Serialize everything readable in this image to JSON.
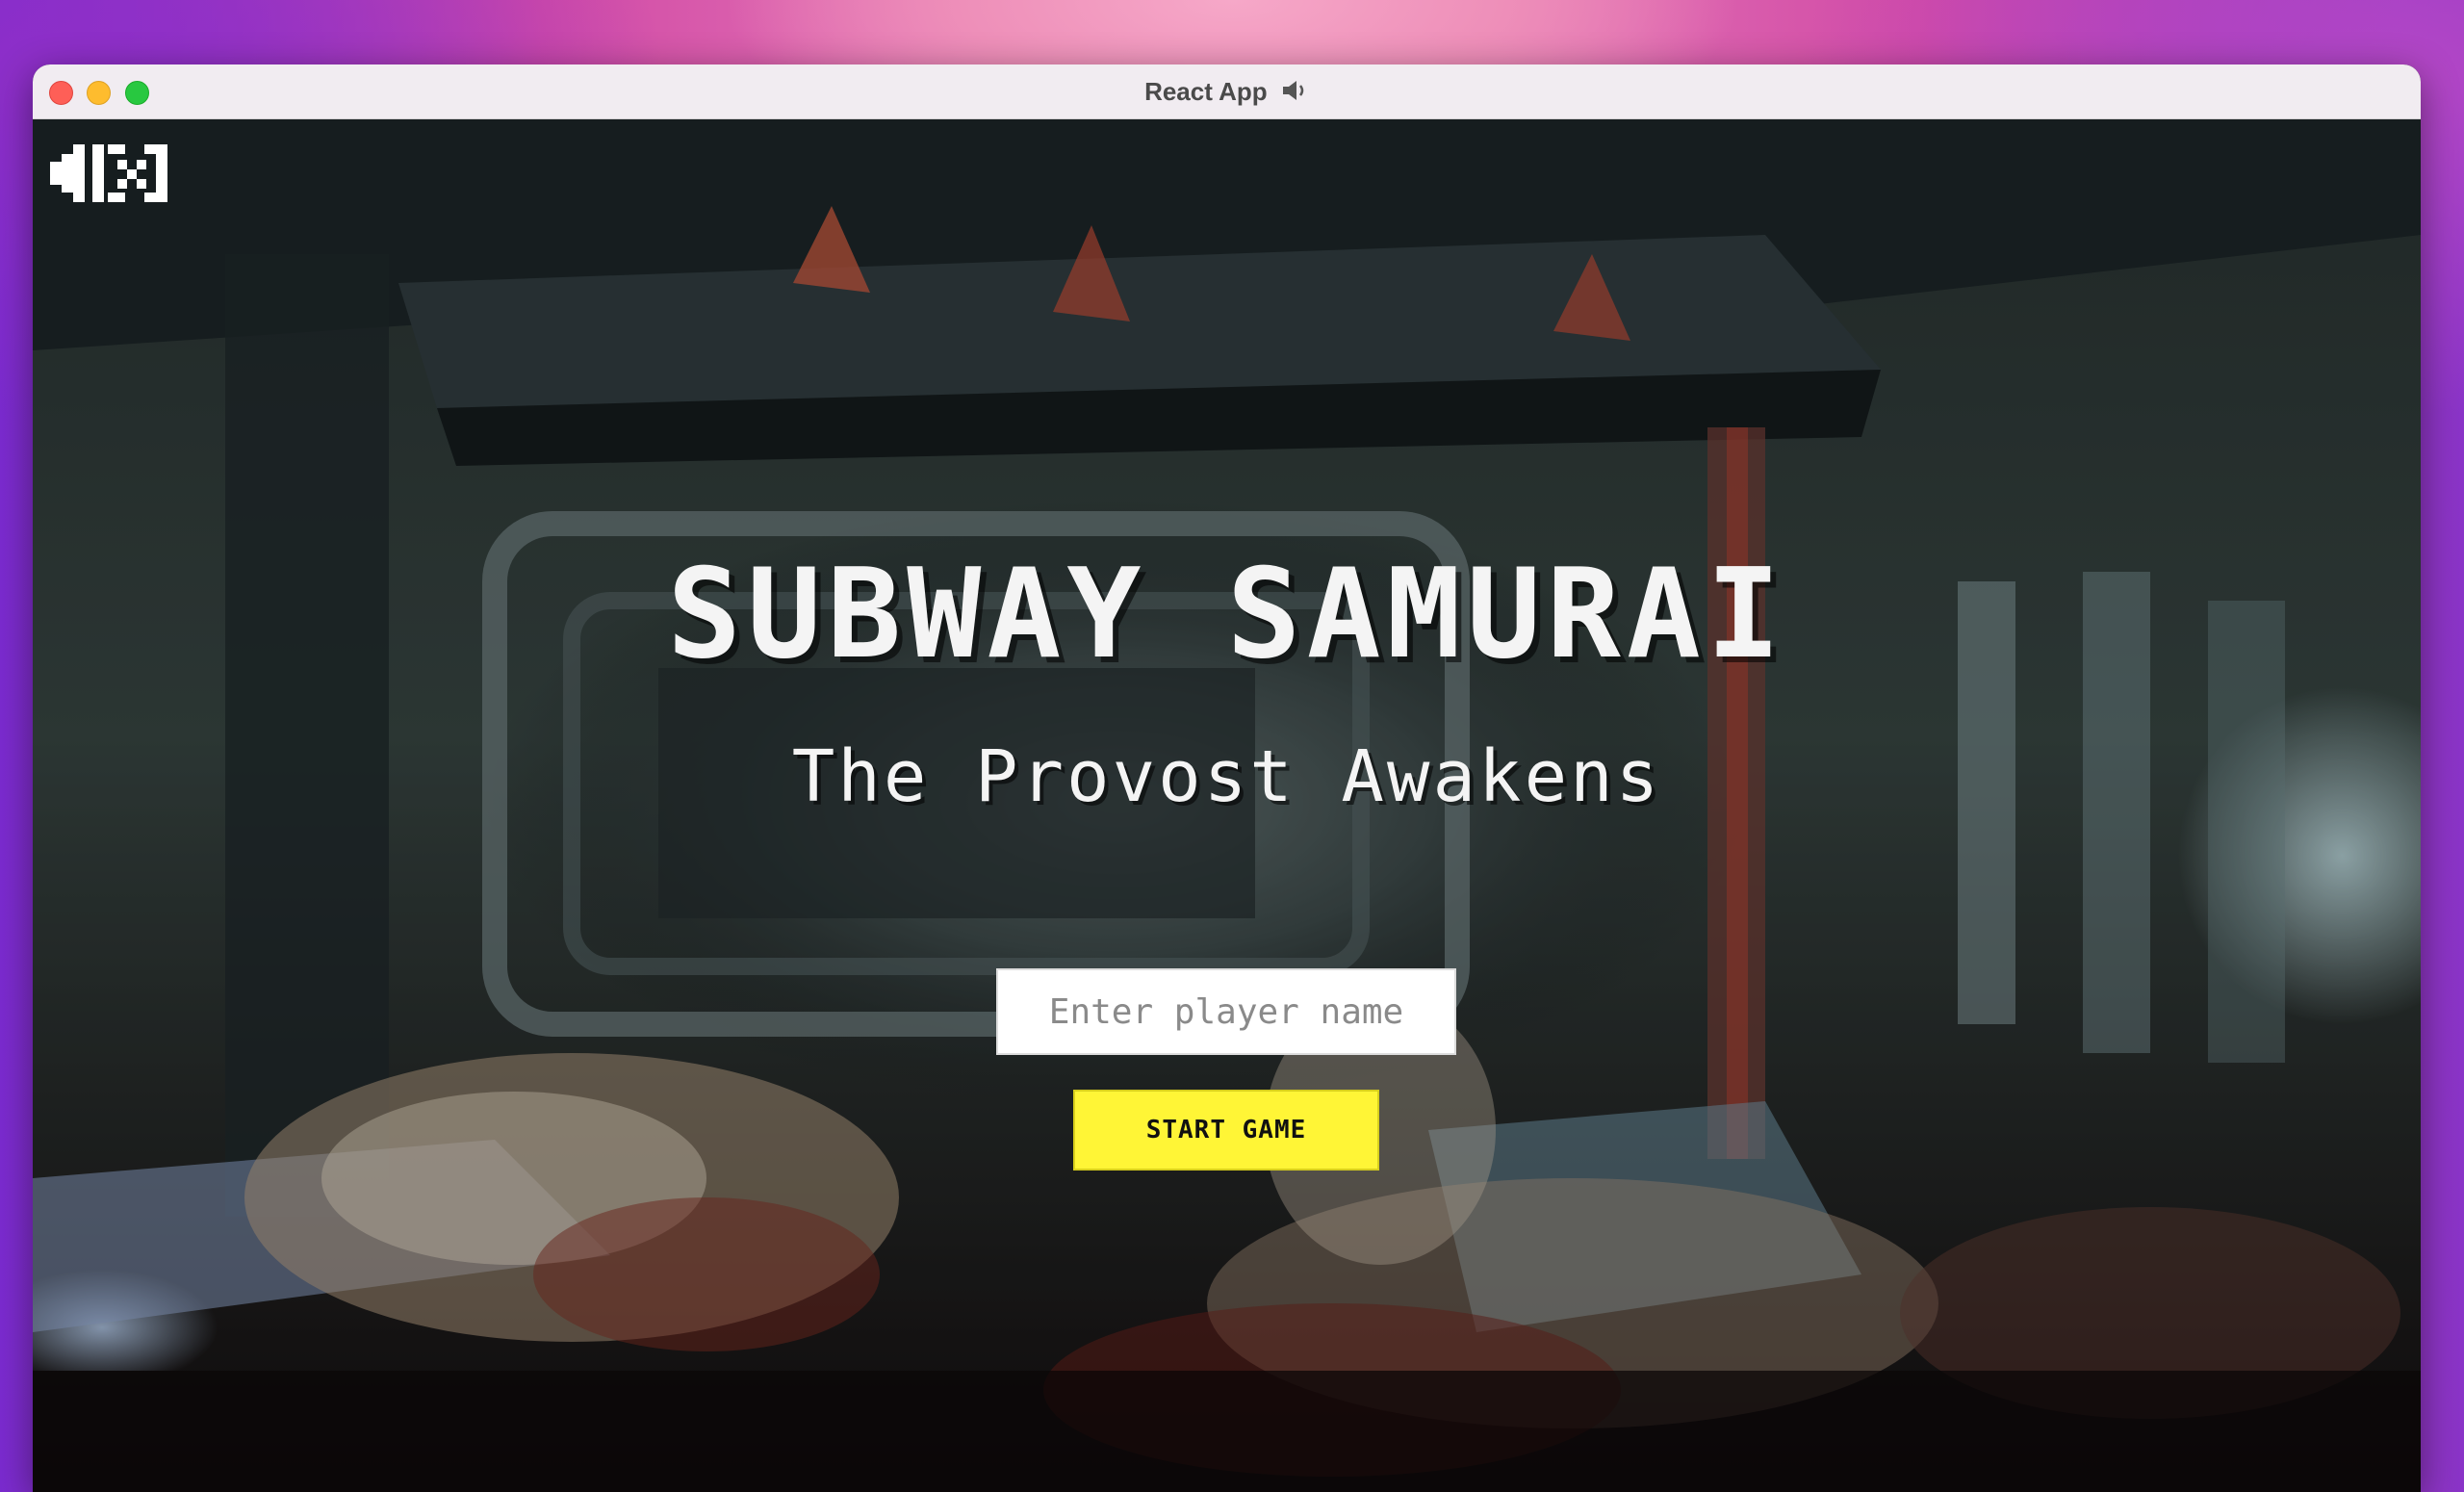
{
  "window": {
    "title": "React App",
    "title_icon": "speaker-icon"
  },
  "game": {
    "title": "SUBWAY SAMURAI",
    "subtitle": "The Provost Awakens",
    "player_input": {
      "value": "",
      "placeholder": "Enter player name"
    },
    "start_label": "START GAME",
    "mute_icon": "sound-muted-icon"
  },
  "colors": {
    "start_button": "#fff536",
    "title_text": "#f4f4f4",
    "titlebar": "#f1ecf1"
  }
}
